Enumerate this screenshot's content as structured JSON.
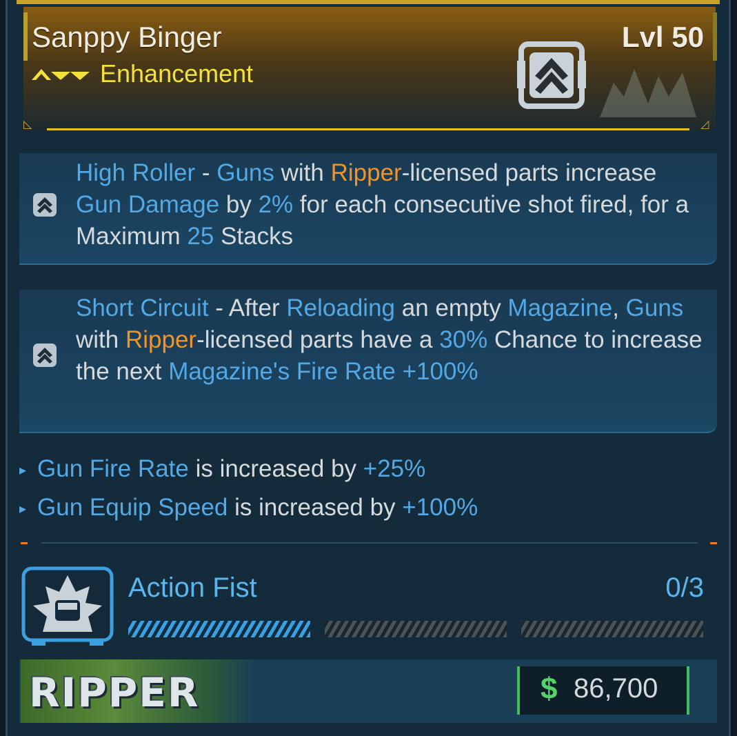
{
  "item": {
    "name": "Sanppy Binger",
    "level": "Lvl 50",
    "rarity": "Enhancement"
  },
  "perks": [
    {
      "icon": "chevron-up-class-icon",
      "segments": [
        {
          "t": "High Roller",
          "c": "b"
        },
        {
          "t": " - ",
          "c": "n"
        },
        {
          "t": "Guns",
          "c": "b"
        },
        {
          "t": " with ",
          "c": "n"
        },
        {
          "t": "Ripper",
          "c": "o"
        },
        {
          "t": "-licensed parts increase ",
          "c": "n"
        },
        {
          "t": "Gun Damage",
          "c": "b"
        },
        {
          "t": " by ",
          "c": "n"
        },
        {
          "t": "2%",
          "c": "b"
        },
        {
          "t": " for each consecutive shot fired, for a Maximum ",
          "c": "n"
        },
        {
          "t": "25",
          "c": "b"
        },
        {
          "t": " Stacks",
          "c": "n"
        }
      ]
    },
    {
      "icon": "chevron-up-class-icon",
      "segments": [
        {
          "t": "Short Circuit",
          "c": "b"
        },
        {
          "t": " - After ",
          "c": "n"
        },
        {
          "t": "Reloading",
          "c": "b"
        },
        {
          "t": " an empty ",
          "c": "n"
        },
        {
          "t": "Magazine",
          "c": "b"
        },
        {
          "t": ", ",
          "c": "n"
        },
        {
          "t": "Guns",
          "c": "b"
        },
        {
          "t": " with ",
          "c": "n"
        },
        {
          "t": "Ripper",
          "c": "o"
        },
        {
          "t": "-licensed parts have a ",
          "c": "n"
        },
        {
          "t": "30%",
          "c": "b"
        },
        {
          "t": " Chance to increase the next ",
          "c": "n"
        },
        {
          "t": "Magazine's Fire Rate +100%",
          "c": "b"
        }
      ]
    }
  ],
  "stats": [
    {
      "name": "Gun Fire Rate",
      "mid": " is increased by ",
      "value": "+25%"
    },
    {
      "name": "Gun Equip Speed",
      "mid": " is increased by ",
      "value": "+100%"
    }
  ],
  "manufacturer_bonus": {
    "name": "Action Fist",
    "count": "0/3",
    "progress_fraction": 0.333
  },
  "manufacturer_logo": "RIPPER",
  "price": {
    "symbol": "$",
    "value": "86,700"
  },
  "colors": {
    "accent_blue": "#52a9e6",
    "accent_orange": "#f39324",
    "rarity_yellow": "#f3e23a",
    "price_green": "#54d36a"
  }
}
